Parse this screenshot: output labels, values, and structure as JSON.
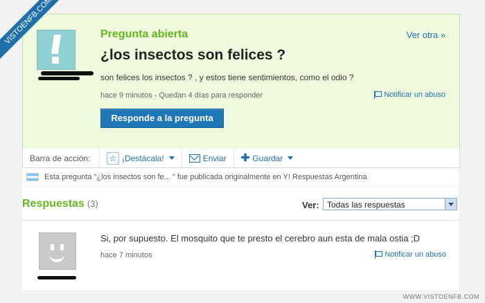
{
  "watermark": {
    "ribbon": "VISTOENFB.COM",
    "footer": "WWW.VISTOENFB.COM"
  },
  "question": {
    "status": "Pregunta abierta",
    "more_link": "Ver otra »",
    "title": "¿los insectos son felices ?",
    "body": "son felices los insectos ? , y estos tiene sentimientos, como el odio ?",
    "meta": "hace 9 minutos - Quedan 4 días para responder",
    "report_link": "Notificar un abuso",
    "answer_button": "Responde a la pregunta"
  },
  "action_bar": {
    "label": "Barra de acción:",
    "highlight": "¡Destácala!",
    "send": "Enviar",
    "save": "Guardar"
  },
  "origin_note": "Esta pregunta \"¿los insectos son fe... \" fue publicada originalmente en Y! Respuestas Argentina",
  "answers": {
    "title": "Respuestas",
    "count": "(3)",
    "filter_label": "Ver:",
    "filter_value": "Todas las respuestas",
    "items": [
      {
        "text": "Si, por supuesto. El mosquito que te presto el cerebro aun esta de mala ostia ;D",
        "time": "hace 7 minutos",
        "report_link": "Notificar un abuso"
      }
    ]
  }
}
